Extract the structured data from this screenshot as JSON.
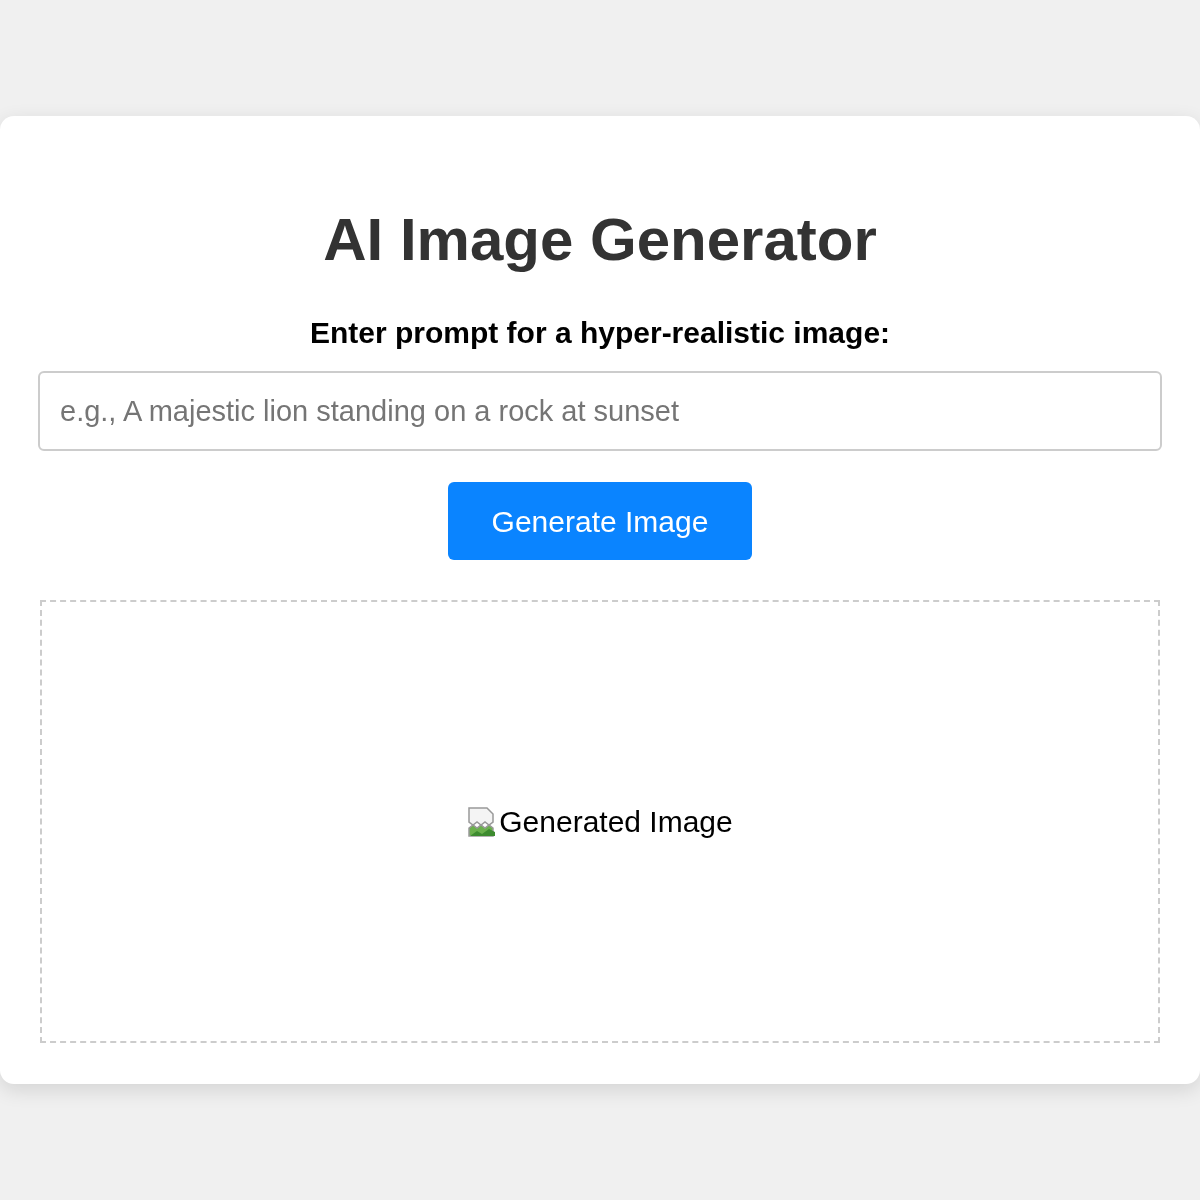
{
  "title": "AI Image Generator",
  "prompt": {
    "label": "Enter prompt for a hyper-realistic image:",
    "placeholder": "e.g., A majestic lion standing on a rock at sunset"
  },
  "generate_button": "Generate Image",
  "result": {
    "alt_text": "Generated Image"
  }
}
